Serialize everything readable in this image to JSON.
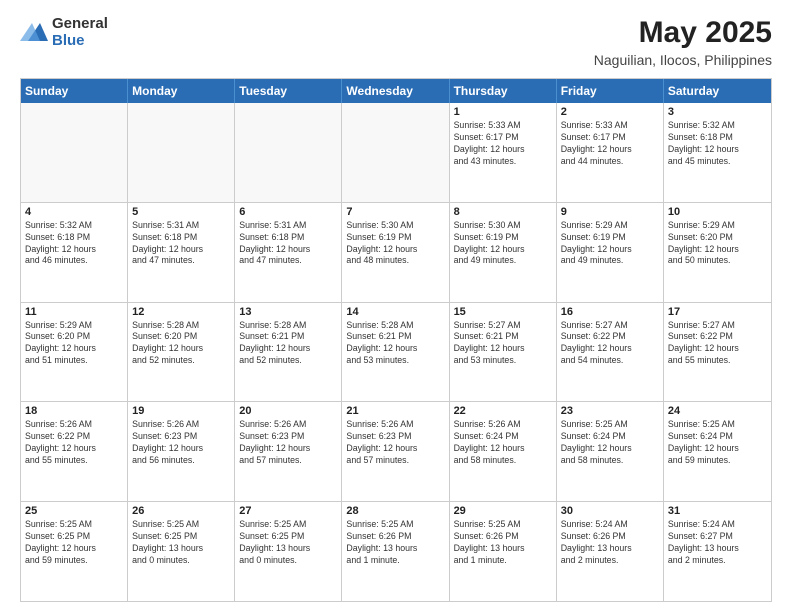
{
  "header": {
    "logo": {
      "general": "General",
      "blue": "Blue"
    },
    "title": "May 2025",
    "location": "Naguilian, Ilocos, Philippines"
  },
  "weekdays": [
    "Sunday",
    "Monday",
    "Tuesday",
    "Wednesday",
    "Thursday",
    "Friday",
    "Saturday"
  ],
  "weeks": [
    [
      {
        "day": "",
        "info": ""
      },
      {
        "day": "",
        "info": ""
      },
      {
        "day": "",
        "info": ""
      },
      {
        "day": "",
        "info": ""
      },
      {
        "day": "1",
        "info": "Sunrise: 5:33 AM\nSunset: 6:17 PM\nDaylight: 12 hours\nand 43 minutes."
      },
      {
        "day": "2",
        "info": "Sunrise: 5:33 AM\nSunset: 6:17 PM\nDaylight: 12 hours\nand 44 minutes."
      },
      {
        "day": "3",
        "info": "Sunrise: 5:32 AM\nSunset: 6:18 PM\nDaylight: 12 hours\nand 45 minutes."
      }
    ],
    [
      {
        "day": "4",
        "info": "Sunrise: 5:32 AM\nSunset: 6:18 PM\nDaylight: 12 hours\nand 46 minutes."
      },
      {
        "day": "5",
        "info": "Sunrise: 5:31 AM\nSunset: 6:18 PM\nDaylight: 12 hours\nand 47 minutes."
      },
      {
        "day": "6",
        "info": "Sunrise: 5:31 AM\nSunset: 6:18 PM\nDaylight: 12 hours\nand 47 minutes."
      },
      {
        "day": "7",
        "info": "Sunrise: 5:30 AM\nSunset: 6:19 PM\nDaylight: 12 hours\nand 48 minutes."
      },
      {
        "day": "8",
        "info": "Sunrise: 5:30 AM\nSunset: 6:19 PM\nDaylight: 12 hours\nand 49 minutes."
      },
      {
        "day": "9",
        "info": "Sunrise: 5:29 AM\nSunset: 6:19 PM\nDaylight: 12 hours\nand 49 minutes."
      },
      {
        "day": "10",
        "info": "Sunrise: 5:29 AM\nSunset: 6:20 PM\nDaylight: 12 hours\nand 50 minutes."
      }
    ],
    [
      {
        "day": "11",
        "info": "Sunrise: 5:29 AM\nSunset: 6:20 PM\nDaylight: 12 hours\nand 51 minutes."
      },
      {
        "day": "12",
        "info": "Sunrise: 5:28 AM\nSunset: 6:20 PM\nDaylight: 12 hours\nand 52 minutes."
      },
      {
        "day": "13",
        "info": "Sunrise: 5:28 AM\nSunset: 6:21 PM\nDaylight: 12 hours\nand 52 minutes."
      },
      {
        "day": "14",
        "info": "Sunrise: 5:28 AM\nSunset: 6:21 PM\nDaylight: 12 hours\nand 53 minutes."
      },
      {
        "day": "15",
        "info": "Sunrise: 5:27 AM\nSunset: 6:21 PM\nDaylight: 12 hours\nand 53 minutes."
      },
      {
        "day": "16",
        "info": "Sunrise: 5:27 AM\nSunset: 6:22 PM\nDaylight: 12 hours\nand 54 minutes."
      },
      {
        "day": "17",
        "info": "Sunrise: 5:27 AM\nSunset: 6:22 PM\nDaylight: 12 hours\nand 55 minutes."
      }
    ],
    [
      {
        "day": "18",
        "info": "Sunrise: 5:26 AM\nSunset: 6:22 PM\nDaylight: 12 hours\nand 55 minutes."
      },
      {
        "day": "19",
        "info": "Sunrise: 5:26 AM\nSunset: 6:23 PM\nDaylight: 12 hours\nand 56 minutes."
      },
      {
        "day": "20",
        "info": "Sunrise: 5:26 AM\nSunset: 6:23 PM\nDaylight: 12 hours\nand 57 minutes."
      },
      {
        "day": "21",
        "info": "Sunrise: 5:26 AM\nSunset: 6:23 PM\nDaylight: 12 hours\nand 57 minutes."
      },
      {
        "day": "22",
        "info": "Sunrise: 5:26 AM\nSunset: 6:24 PM\nDaylight: 12 hours\nand 58 minutes."
      },
      {
        "day": "23",
        "info": "Sunrise: 5:25 AM\nSunset: 6:24 PM\nDaylight: 12 hours\nand 58 minutes."
      },
      {
        "day": "24",
        "info": "Sunrise: 5:25 AM\nSunset: 6:24 PM\nDaylight: 12 hours\nand 59 minutes."
      }
    ],
    [
      {
        "day": "25",
        "info": "Sunrise: 5:25 AM\nSunset: 6:25 PM\nDaylight: 12 hours\nand 59 minutes."
      },
      {
        "day": "26",
        "info": "Sunrise: 5:25 AM\nSunset: 6:25 PM\nDaylight: 13 hours\nand 0 minutes."
      },
      {
        "day": "27",
        "info": "Sunrise: 5:25 AM\nSunset: 6:25 PM\nDaylight: 13 hours\nand 0 minutes."
      },
      {
        "day": "28",
        "info": "Sunrise: 5:25 AM\nSunset: 6:26 PM\nDaylight: 13 hours\nand 1 minute."
      },
      {
        "day": "29",
        "info": "Sunrise: 5:25 AM\nSunset: 6:26 PM\nDaylight: 13 hours\nand 1 minute."
      },
      {
        "day": "30",
        "info": "Sunrise: 5:24 AM\nSunset: 6:26 PM\nDaylight: 13 hours\nand 2 minutes."
      },
      {
        "day": "31",
        "info": "Sunrise: 5:24 AM\nSunset: 6:27 PM\nDaylight: 13 hours\nand 2 minutes."
      }
    ]
  ]
}
